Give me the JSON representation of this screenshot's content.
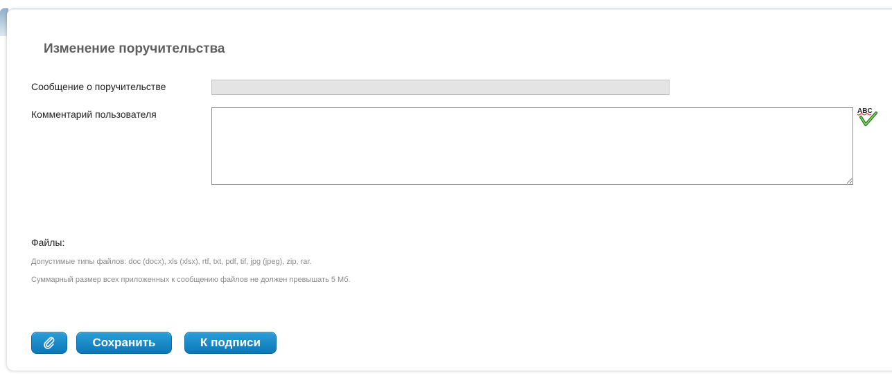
{
  "form": {
    "title": "Изменение поручительства",
    "message_label": "Сообщение о поручительстве",
    "message_value": "",
    "comment_label": "Комментарий пользователя",
    "comment_value": ""
  },
  "files": {
    "label": "Файлы:",
    "allowed_types": "Допустимые типы файлов: doc (docx), xls (xlsx), rtf, txt, pdf, tif, jpg (jpeg), zip, rar.",
    "size_limit": "Суммарный размер всех приложенных к сообщению файлов не должен превышать 5 Мб."
  },
  "icons": {
    "spellcheck": "spellcheck-icon",
    "attach": "paperclip-icon"
  },
  "buttons": {
    "save_label": "Сохранить",
    "sign_label": "К подписи"
  },
  "colors": {
    "button_top": "#2a9ed8",
    "button_bottom": "#0c78b7",
    "title_text": "#5f5f5f",
    "disabled_input": "#e4e4e4"
  }
}
